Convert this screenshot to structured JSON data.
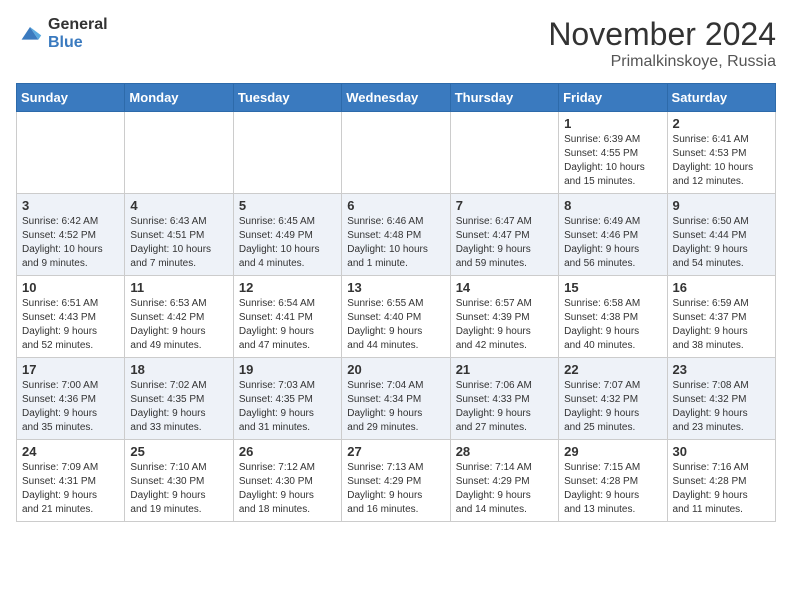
{
  "header": {
    "logo_general": "General",
    "logo_blue": "Blue",
    "month_title": "November 2024",
    "location": "Primalkinskoye, Russia"
  },
  "weekdays": [
    "Sunday",
    "Monday",
    "Tuesday",
    "Wednesday",
    "Thursday",
    "Friday",
    "Saturday"
  ],
  "weeks": [
    [
      {
        "day": "",
        "info": ""
      },
      {
        "day": "",
        "info": ""
      },
      {
        "day": "",
        "info": ""
      },
      {
        "day": "",
        "info": ""
      },
      {
        "day": "",
        "info": ""
      },
      {
        "day": "1",
        "info": "Sunrise: 6:39 AM\nSunset: 4:55 PM\nDaylight: 10 hours\nand 15 minutes."
      },
      {
        "day": "2",
        "info": "Sunrise: 6:41 AM\nSunset: 4:53 PM\nDaylight: 10 hours\nand 12 minutes."
      }
    ],
    [
      {
        "day": "3",
        "info": "Sunrise: 6:42 AM\nSunset: 4:52 PM\nDaylight: 10 hours\nand 9 minutes."
      },
      {
        "day": "4",
        "info": "Sunrise: 6:43 AM\nSunset: 4:51 PM\nDaylight: 10 hours\nand 7 minutes."
      },
      {
        "day": "5",
        "info": "Sunrise: 6:45 AM\nSunset: 4:49 PM\nDaylight: 10 hours\nand 4 minutes."
      },
      {
        "day": "6",
        "info": "Sunrise: 6:46 AM\nSunset: 4:48 PM\nDaylight: 10 hours\nand 1 minute."
      },
      {
        "day": "7",
        "info": "Sunrise: 6:47 AM\nSunset: 4:47 PM\nDaylight: 9 hours\nand 59 minutes."
      },
      {
        "day": "8",
        "info": "Sunrise: 6:49 AM\nSunset: 4:46 PM\nDaylight: 9 hours\nand 56 minutes."
      },
      {
        "day": "9",
        "info": "Sunrise: 6:50 AM\nSunset: 4:44 PM\nDaylight: 9 hours\nand 54 minutes."
      }
    ],
    [
      {
        "day": "10",
        "info": "Sunrise: 6:51 AM\nSunset: 4:43 PM\nDaylight: 9 hours\nand 52 minutes."
      },
      {
        "day": "11",
        "info": "Sunrise: 6:53 AM\nSunset: 4:42 PM\nDaylight: 9 hours\nand 49 minutes."
      },
      {
        "day": "12",
        "info": "Sunrise: 6:54 AM\nSunset: 4:41 PM\nDaylight: 9 hours\nand 47 minutes."
      },
      {
        "day": "13",
        "info": "Sunrise: 6:55 AM\nSunset: 4:40 PM\nDaylight: 9 hours\nand 44 minutes."
      },
      {
        "day": "14",
        "info": "Sunrise: 6:57 AM\nSunset: 4:39 PM\nDaylight: 9 hours\nand 42 minutes."
      },
      {
        "day": "15",
        "info": "Sunrise: 6:58 AM\nSunset: 4:38 PM\nDaylight: 9 hours\nand 40 minutes."
      },
      {
        "day": "16",
        "info": "Sunrise: 6:59 AM\nSunset: 4:37 PM\nDaylight: 9 hours\nand 38 minutes."
      }
    ],
    [
      {
        "day": "17",
        "info": "Sunrise: 7:00 AM\nSunset: 4:36 PM\nDaylight: 9 hours\nand 35 minutes."
      },
      {
        "day": "18",
        "info": "Sunrise: 7:02 AM\nSunset: 4:35 PM\nDaylight: 9 hours\nand 33 minutes."
      },
      {
        "day": "19",
        "info": "Sunrise: 7:03 AM\nSunset: 4:35 PM\nDaylight: 9 hours\nand 31 minutes."
      },
      {
        "day": "20",
        "info": "Sunrise: 7:04 AM\nSunset: 4:34 PM\nDaylight: 9 hours\nand 29 minutes."
      },
      {
        "day": "21",
        "info": "Sunrise: 7:06 AM\nSunset: 4:33 PM\nDaylight: 9 hours\nand 27 minutes."
      },
      {
        "day": "22",
        "info": "Sunrise: 7:07 AM\nSunset: 4:32 PM\nDaylight: 9 hours\nand 25 minutes."
      },
      {
        "day": "23",
        "info": "Sunrise: 7:08 AM\nSunset: 4:32 PM\nDaylight: 9 hours\nand 23 minutes."
      }
    ],
    [
      {
        "day": "24",
        "info": "Sunrise: 7:09 AM\nSunset: 4:31 PM\nDaylight: 9 hours\nand 21 minutes."
      },
      {
        "day": "25",
        "info": "Sunrise: 7:10 AM\nSunset: 4:30 PM\nDaylight: 9 hours\nand 19 minutes."
      },
      {
        "day": "26",
        "info": "Sunrise: 7:12 AM\nSunset: 4:30 PM\nDaylight: 9 hours\nand 18 minutes."
      },
      {
        "day": "27",
        "info": "Sunrise: 7:13 AM\nSunset: 4:29 PM\nDaylight: 9 hours\nand 16 minutes."
      },
      {
        "day": "28",
        "info": "Sunrise: 7:14 AM\nSunset: 4:29 PM\nDaylight: 9 hours\nand 14 minutes."
      },
      {
        "day": "29",
        "info": "Sunrise: 7:15 AM\nSunset: 4:28 PM\nDaylight: 9 hours\nand 13 minutes."
      },
      {
        "day": "30",
        "info": "Sunrise: 7:16 AM\nSunset: 4:28 PM\nDaylight: 9 hours\nand 11 minutes."
      }
    ]
  ]
}
